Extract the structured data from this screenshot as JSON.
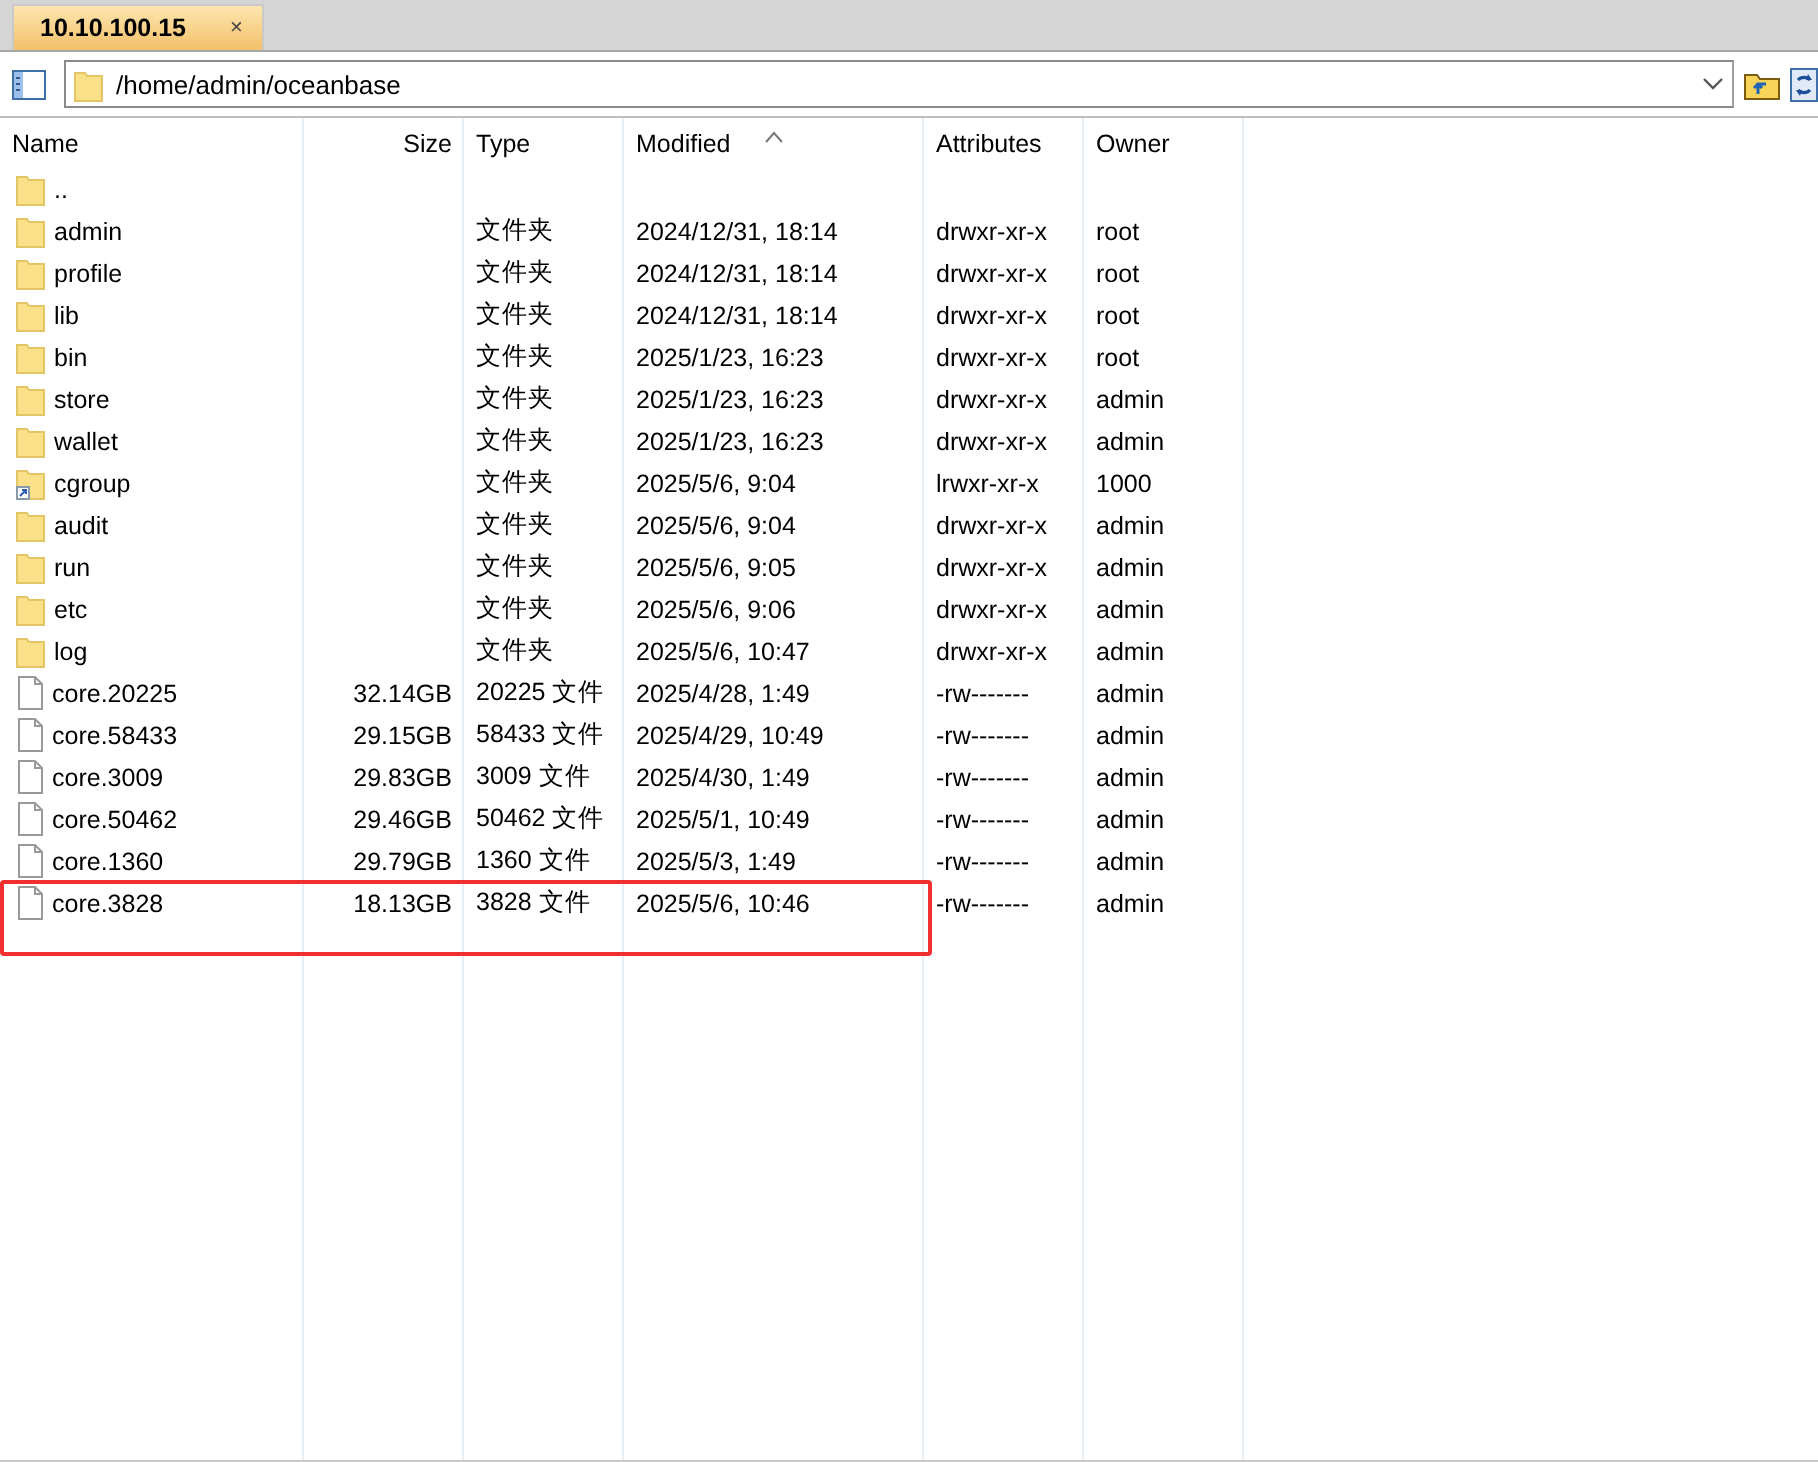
{
  "tabs": [
    {
      "label": "10.10.100.15",
      "close": "×",
      "selected": true
    }
  ],
  "address": {
    "path": "/home/admin/oceanbase"
  },
  "columns": [
    {
      "label": "Name",
      "sorted": false
    },
    {
      "label": "Size",
      "sorted": false
    },
    {
      "label": "Type",
      "sorted": false
    },
    {
      "label": "Modified",
      "sorted": true
    },
    {
      "label": "Attributes",
      "sorted": false
    },
    {
      "label": "Owner",
      "sorted": false
    }
  ],
  "rows": [
    {
      "kind": "parent",
      "name": "..",
      "size": "",
      "type": "",
      "modified": "",
      "attributes": "",
      "owner": "",
      "highlighted": false
    },
    {
      "kind": "folder",
      "name": "admin",
      "size": "",
      "type": "文件夹",
      "modified": "2024/12/31, 18:14",
      "attributes": "drwxr-xr-x",
      "owner": "root",
      "highlighted": false
    },
    {
      "kind": "folder",
      "name": "profile",
      "size": "",
      "type": "文件夹",
      "modified": "2024/12/31, 18:14",
      "attributes": "drwxr-xr-x",
      "owner": "root",
      "highlighted": false
    },
    {
      "kind": "folder",
      "name": "lib",
      "size": "",
      "type": "文件夹",
      "modified": "2024/12/31, 18:14",
      "attributes": "drwxr-xr-x",
      "owner": "root",
      "highlighted": false
    },
    {
      "kind": "folder",
      "name": "bin",
      "size": "",
      "type": "文件夹",
      "modified": "2025/1/23, 16:23",
      "attributes": "drwxr-xr-x",
      "owner": "root",
      "highlighted": false
    },
    {
      "kind": "folder",
      "name": "store",
      "size": "",
      "type": "文件夹",
      "modified": "2025/1/23, 16:23",
      "attributes": "drwxr-xr-x",
      "owner": "admin",
      "highlighted": false
    },
    {
      "kind": "folder",
      "name": "wallet",
      "size": "",
      "type": "文件夹",
      "modified": "2025/1/23, 16:23",
      "attributes": "drwxr-xr-x",
      "owner": "admin",
      "highlighted": false
    },
    {
      "kind": "link",
      "name": "cgroup",
      "size": "",
      "type": "文件夹",
      "modified": "2025/5/6, 9:04",
      "attributes": "lrwxr-xr-x",
      "owner": "1000",
      "highlighted": false
    },
    {
      "kind": "folder",
      "name": "audit",
      "size": "",
      "type": "文件夹",
      "modified": "2025/5/6, 9:04",
      "attributes": "drwxr-xr-x",
      "owner": "admin",
      "highlighted": false
    },
    {
      "kind": "folder",
      "name": "run",
      "size": "",
      "type": "文件夹",
      "modified": "2025/5/6, 9:05",
      "attributes": "drwxr-xr-x",
      "owner": "admin",
      "highlighted": false
    },
    {
      "kind": "folder",
      "name": "etc",
      "size": "",
      "type": "文件夹",
      "modified": "2025/5/6, 9:06",
      "attributes": "drwxr-xr-x",
      "owner": "admin",
      "highlighted": false
    },
    {
      "kind": "folder",
      "name": "log",
      "size": "",
      "type": "文件夹",
      "modified": "2025/5/6, 10:47",
      "attributes": "drwxr-xr-x",
      "owner": "admin",
      "highlighted": false
    },
    {
      "kind": "file",
      "name": "core.20225",
      "size": "32.14GB",
      "type": "20225 文件",
      "modified": "2025/4/28, 1:49",
      "attributes": "-rw-------",
      "owner": "admin",
      "highlighted": false
    },
    {
      "kind": "file",
      "name": "core.58433",
      "size": "29.15GB",
      "type": "58433 文件",
      "modified": "2025/4/29, 10:49",
      "attributes": "-rw-------",
      "owner": "admin",
      "highlighted": false
    },
    {
      "kind": "file",
      "name": "core.3009",
      "size": "29.83GB",
      "type": "3009 文件",
      "modified": "2025/4/30, 1:49",
      "attributes": "-rw-------",
      "owner": "admin",
      "highlighted": false
    },
    {
      "kind": "file",
      "name": "core.50462",
      "size": "29.46GB",
      "type": "50462 文件",
      "modified": "2025/5/1, 10:49",
      "attributes": "-rw-------",
      "owner": "admin",
      "highlighted": false
    },
    {
      "kind": "file",
      "name": "core.1360",
      "size": "29.79GB",
      "type": "1360 文件",
      "modified": "2025/5/3, 1:49",
      "attributes": "-rw-------",
      "owner": "admin",
      "highlighted": false
    },
    {
      "kind": "file",
      "name": "core.3828",
      "size": "18.13GB",
      "type": "3828 文件",
      "modified": "2025/5/6, 10:46",
      "attributes": "-rw-------",
      "owner": "admin",
      "highlighted": true
    }
  ]
}
